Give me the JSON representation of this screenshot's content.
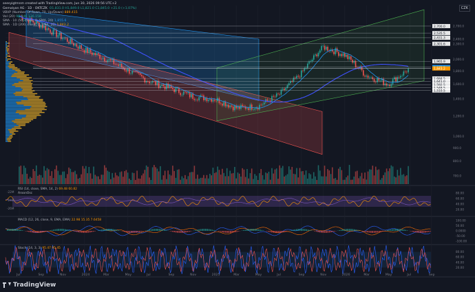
{
  "header": {
    "author": "seesyigtmnm created with TradingView.com, Jun 30, 2026 09:56 UTC+2",
    "symbol_line": "Gemalyan AG · 1D · OKTCZK",
    "ohlc": "O1,831.0  H1,849.0  L1,821.0  C1,845.0  +21.0 (+1.07%)",
    "vbp_line": "VBVP (Number Of Rows, 70, Up/Down)",
    "vbp_value": "889.415",
    "vol_line": "Vol (20)",
    "vol_value": "98.64K  136.158",
    "sma_10_line": "SMA · 10 (50, close, 0, SMA, 20)",
    "sma_10_value": "1,855.6",
    "sma_200_line": "SMA · 1D (200, close, 0, SMA, 20)",
    "sma_200_value": "1,843.2"
  },
  "currency_badge": "CZK",
  "brand": "TradingView",
  "chart_data": [
    {
      "type": "line",
      "panel": "price",
      "x": [
        "Jul",
        "Sep",
        "Nov",
        "2024",
        "Mar",
        "May",
        "Jul",
        "Sep",
        "Nov",
        "2025",
        "Mar",
        "May",
        "Jul",
        "Sep",
        "Nov",
        "2026",
        "Mar",
        "May",
        "Jul",
        "Sep"
      ],
      "series": [
        {
          "name": "Close",
          "values": [
            2950,
            2720,
            2430,
            2180,
            2010,
            1810,
            1640,
            1540,
            1430,
            1400,
            1290,
            1310,
            1460,
            1760,
            2240,
            2080,
            1730,
            1600,
            1840,
            null
          ]
        }
      ],
      "y_ticks": [
        "2,700.0",
        "2,400.0",
        "2,300.0",
        "2,000.0",
        "1,800.0",
        "1,600.0",
        "1,400.0",
        "1,200.0",
        "1,000.0",
        "900.0",
        "800.0",
        "700.0"
      ],
      "price_labels": [
        {
          "text": "2,700.0",
          "value": 2700,
          "color": "#d1d4dc"
        },
        {
          "text": "2,535.5",
          "value": 2535,
          "color": "#d1d4dc"
        },
        {
          "text": "2,431.3",
          "value": 2431,
          "color": "#d1d4dc"
        },
        {
          "text": "2,301.6",
          "value": 2302,
          "color": "#d1d4dc"
        },
        {
          "text": "1,965.9",
          "value": 1966,
          "color": "#d1d4dc"
        },
        {
          "text": "1,865.5",
          "value": 1866,
          "color": "#2196f3"
        },
        {
          "text": "1,845.0",
          "value": 1845,
          "color": "#26a69a"
        },
        {
          "text": "1,843.2",
          "value": 1843,
          "color": "#ff9800"
        },
        {
          "text": "1,684.5",
          "value": 1685,
          "color": "#d1d4dc"
        },
        {
          "text": "1,641.0",
          "value": 1641,
          "color": "#d1d4dc"
        },
        {
          "text": "1,592.5",
          "value": 1593,
          "color": "#d1d4dc"
        },
        {
          "text": "1,548.5",
          "value": 1549,
          "color": "#d1d4dc"
        },
        {
          "text": "1,510.5",
          "value": 1511,
          "color": "#d1d4dc"
        }
      ],
      "ylim": [
        650,
        3250
      ]
    },
    {
      "type": "line",
      "panel": "rsi",
      "title": "RSI (14, close, SMA, 14, 2)",
      "value_text": "69.48  60.82",
      "sub_title": "AroonOsc",
      "y_ticks": [
        "80.00",
        "60.00",
        "40.00",
        "20.00"
      ],
      "left_ticks": [
        "-22M",
        "-24M",
        "-26M"
      ],
      "ylim": [
        0,
        100
      ]
    },
    {
      "type": "line",
      "panel": "macd",
      "title": "MACD (12, 26, close, 9, EMA, EMA)",
      "value_text": "22.98  15.35  7.6458",
      "y_ticks": [
        "100.00",
        "50.00",
        "0.0000",
        "-50.00",
        "-100.00"
      ],
      "ylim": [
        -120,
        120
      ]
    },
    {
      "type": "line",
      "panel": "stoch",
      "title": "Stoch (14, 3, 3)",
      "value_text": "95.47  95.45",
      "y_ticks": [
        "80.00",
        "60.00",
        "40.00",
        "20.00"
      ],
      "ylim": [
        0,
        100
      ]
    }
  ]
}
